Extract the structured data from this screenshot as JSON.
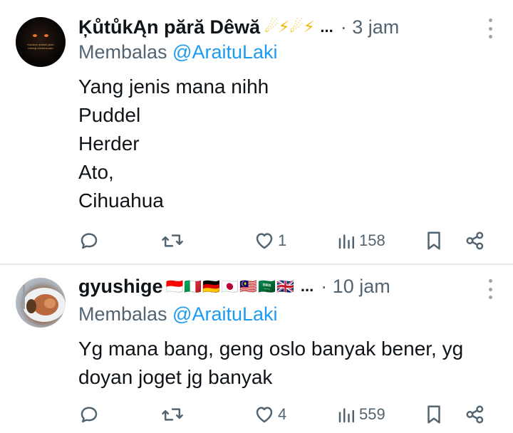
{
  "posts": [
    {
      "author": "ĶůtůkĄn pără Dêwă",
      "author_emoji": "☄⚡☄⚡",
      "truncation": "...",
      "time": "· 3 jam",
      "reply_prefix": "Membalas ",
      "reply_handle": "@AraituLaki",
      "text": "Yang jenis mana nihh\nPuddel\nHerder\nAto,\nCihuahua",
      "avatar_text": "Kutukan adalah jalan menuju kehancuran",
      "icons": {
        "reply": "reply-icon",
        "repost": "repost-icon",
        "like": "heart-icon",
        "views": "views-icon",
        "bookmark": "bookmark-icon",
        "share": "share-icon",
        "more": "more-icon"
      },
      "stats": {
        "replies": "",
        "reposts": "",
        "likes": "1",
        "views": "158"
      }
    },
    {
      "author": "gyushige",
      "author_emoji": "🇮🇩🇮🇹🇩🇪🇯🇵🇲🇾🇸🇦🇬🇧",
      "truncation": "...",
      "time": "· 10 jam",
      "reply_prefix": "Membalas ",
      "reply_handle": "@AraituLaki",
      "text": "Yg mana bang, geng oslo banyak bener, yg\ndoyan joget jg banyak",
      "icons": {
        "reply": "reply-icon",
        "repost": "repost-icon",
        "like": "heart-icon",
        "views": "views-icon",
        "bookmark": "bookmark-icon",
        "share": "share-icon",
        "more": "more-icon"
      },
      "stats": {
        "replies": "",
        "reposts": "",
        "likes": "4",
        "views": "559"
      }
    }
  ],
  "colors": {
    "text": "#0f1419",
    "muted": "#536471",
    "link": "#1d9bf0",
    "divider": "#e7e9ea"
  }
}
